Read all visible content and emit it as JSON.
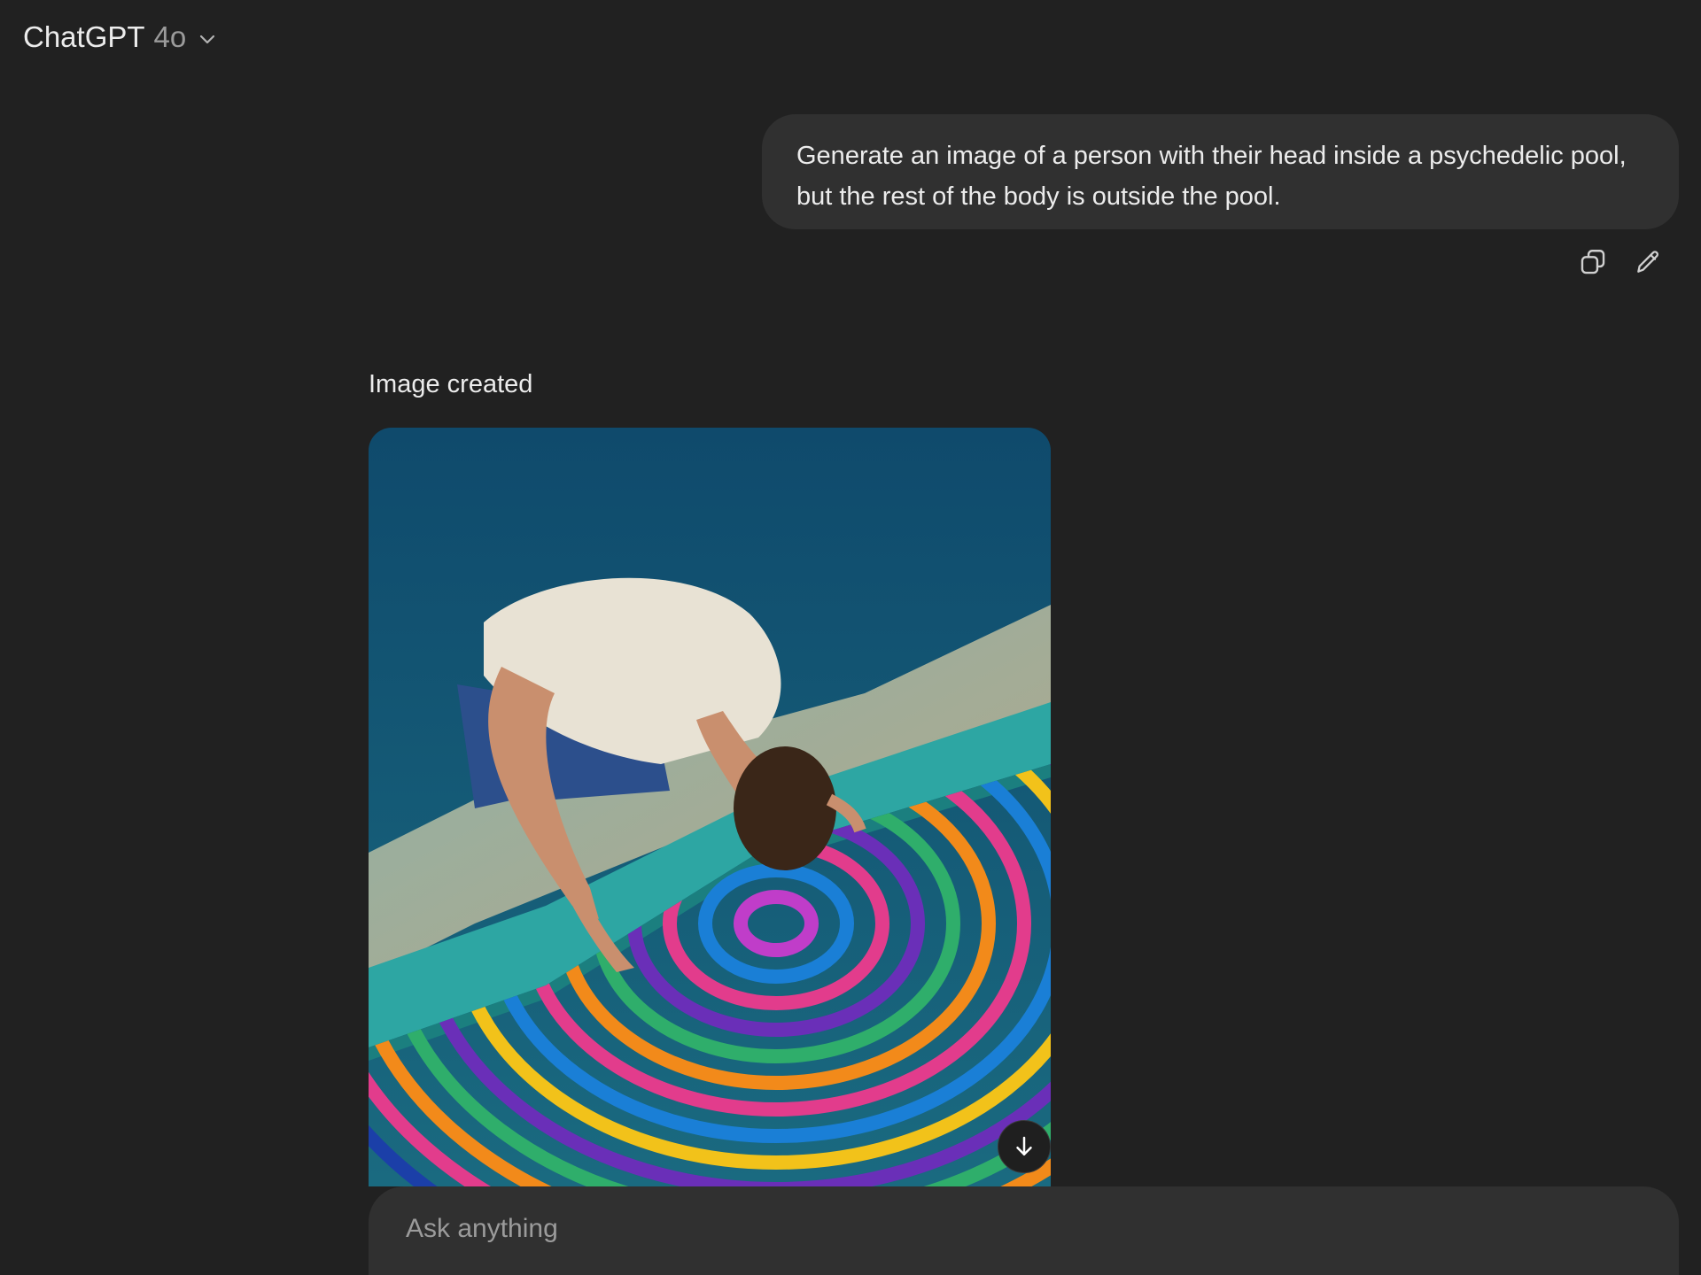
{
  "header": {
    "app_name": "ChatGPT",
    "model": "4o",
    "icon": "chevron-down-icon"
  },
  "conversation": {
    "user_message": "Generate an image of a person with their head inside a psychedelic pool, but the rest of the body is outside the pool.",
    "user_actions": [
      {
        "name": "copy",
        "icon": "copy-icon"
      },
      {
        "name": "edit",
        "icon": "pencil-icon"
      }
    ],
    "assistant": {
      "status": "Image created",
      "image_subject": "person-head-in-psychedelic-pool",
      "download_icon": "download-arrow-icon"
    }
  },
  "composer": {
    "placeholder": "Ask anything"
  },
  "colors": {
    "background": "#212121",
    "bubble": "#303030",
    "text": "#ececec",
    "muted": "#9b9b9b"
  }
}
